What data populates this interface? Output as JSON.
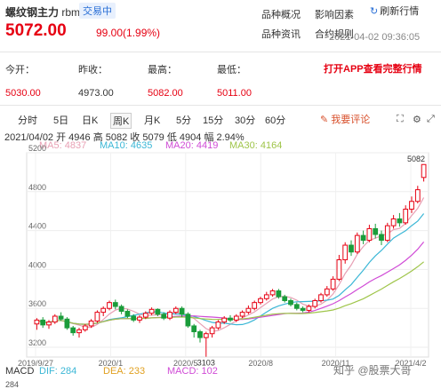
{
  "header": {
    "title": "螺纹钢主力",
    "unit": "rbm",
    "status": "交易中",
    "price": "5072.00",
    "change": "99.00(1.99%)",
    "links": [
      "品种概况",
      "影响因素",
      "品种资讯",
      "合约规则"
    ],
    "refresh": "刷新行情",
    "datetime": "2021-04-02 09:36:05"
  },
  "quote": {
    "labels": [
      "今开：",
      "昨收：",
      "最高：",
      "最低："
    ],
    "values": [
      "5030.00",
      "4973.00",
      "5082.00",
      "5011.00"
    ],
    "open_app": "打开APP查看完整行情"
  },
  "tabs": [
    "分时",
    "5日",
    "日K",
    "周K",
    "月K",
    "5分",
    "15分",
    "30分",
    "60分"
  ],
  "active_tab": "周K",
  "comment_label": "我要评论",
  "ohlc_line": "2021/04/02  开 4946  高 5082  收 5079  低 4904  幅 2.94%",
  "ma": [
    {
      "label": "MA5: 4837",
      "color": "#e8a0b4"
    },
    {
      "label": "MA10: 4635",
      "color": "#3bb7d6"
    },
    {
      "label": "MA20: 4419",
      "color": "#d04bd6"
    },
    {
      "label": "MA30: 4164",
      "color": "#9fc54a"
    }
  ],
  "macd": [
    {
      "label": "MACD",
      "color": "#333333"
    },
    {
      "label": "DIF: 284",
      "color": "#3bb7d6"
    },
    {
      "label": "DEA: 233",
      "color": "#e0a020"
    },
    {
      "label": "MACD: 102",
      "color": "#d04bd6"
    }
  ],
  "macd_axis": "284",
  "watermark": "知乎 @股票大哥",
  "chart_data": {
    "type": "candlestick",
    "y_ticks": [
      "5200",
      "4800",
      "4400",
      "4000",
      "3600",
      "3200"
    ],
    "ylim": [
      3100,
      5200
    ],
    "x_ticks": [
      "2019/9/27",
      "2020/1",
      "2020/5",
      "2020/8",
      "2020/11",
      "2021/4/2"
    ],
    "high_label": "5082",
    "low_label": "3103",
    "candles": [
      [
        3440,
        3480,
        3380,
        3500
      ],
      [
        3480,
        3430,
        3400,
        3510
      ],
      [
        3430,
        3460,
        3390,
        3480
      ],
      [
        3460,
        3520,
        3440,
        3540
      ],
      [
        3520,
        3490,
        3470,
        3560
      ],
      [
        3490,
        3400,
        3380,
        3510
      ],
      [
        3400,
        3350,
        3320,
        3420
      ],
      [
        3350,
        3380,
        3300,
        3400
      ],
      [
        3380,
        3420,
        3360,
        3440
      ],
      [
        3420,
        3470,
        3400,
        3490
      ],
      [
        3470,
        3560,
        3450,
        3580
      ],
      [
        3560,
        3600,
        3520,
        3620
      ],
      [
        3600,
        3660,
        3580,
        3680
      ],
      [
        3660,
        3620,
        3590,
        3690
      ],
      [
        3620,
        3570,
        3540,
        3640
      ],
      [
        3570,
        3520,
        3500,
        3590
      ],
      [
        3520,
        3480,
        3460,
        3540
      ],
      [
        3480,
        3510,
        3450,
        3530
      ],
      [
        3510,
        3550,
        3490,
        3570
      ],
      [
        3550,
        3590,
        3530,
        3610
      ],
      [
        3590,
        3540,
        3520,
        3600
      ],
      [
        3540,
        3500,
        3480,
        3560
      ],
      [
        3500,
        3560,
        3480,
        3580
      ],
      [
        3560,
        3600,
        3540,
        3620
      ],
      [
        3600,
        3540,
        3510,
        3620
      ],
      [
        3540,
        3420,
        3400,
        3560
      ],
      [
        3420,
        3360,
        3300,
        3440
      ],
      [
        3360,
        3300,
        3250,
        3380
      ],
      [
        3300,
        3340,
        3103,
        3360
      ],
      [
        3340,
        3400,
        3300,
        3420
      ],
      [
        3400,
        3460,
        3380,
        3480
      ],
      [
        3460,
        3500,
        3440,
        3520
      ],
      [
        3500,
        3480,
        3460,
        3530
      ],
      [
        3480,
        3520,
        3460,
        3540
      ],
      [
        3520,
        3560,
        3500,
        3580
      ],
      [
        3560,
        3600,
        3540,
        3630
      ],
      [
        3600,
        3660,
        3580,
        3680
      ],
      [
        3660,
        3700,
        3640,
        3720
      ],
      [
        3700,
        3740,
        3680,
        3770
      ],
      [
        3740,
        3780,
        3720,
        3800
      ],
      [
        3780,
        3720,
        3700,
        3800
      ],
      [
        3720,
        3680,
        3660,
        3740
      ],
      [
        3680,
        3640,
        3620,
        3700
      ],
      [
        3640,
        3600,
        3580,
        3660
      ],
      [
        3600,
        3580,
        3560,
        3620
      ],
      [
        3580,
        3620,
        3560,
        3640
      ],
      [
        3620,
        3680,
        3600,
        3700
      ],
      [
        3680,
        3740,
        3660,
        3760
      ],
      [
        3740,
        3800,
        3720,
        3830
      ],
      [
        3800,
        3900,
        3780,
        3930
      ],
      [
        3900,
        4100,
        3880,
        4150
      ],
      [
        4100,
        4250,
        4060,
        4280
      ],
      [
        4250,
        4180,
        4140,
        4300
      ],
      [
        4180,
        4350,
        4160,
        4380
      ],
      [
        4350,
        4300,
        4260,
        4400
      ],
      [
        4300,
        4420,
        4280,
        4460
      ],
      [
        4420,
        4360,
        4320,
        4470
      ],
      [
        4360,
        4300,
        4250,
        4400
      ],
      [
        4300,
        4450,
        4280,
        4480
      ],
      [
        4450,
        4520,
        4420,
        4560
      ],
      [
        4520,
        4480,
        4440,
        4580
      ],
      [
        4480,
        4620,
        4460,
        4660
      ],
      [
        4620,
        4700,
        4580,
        4750
      ],
      [
        4700,
        4820,
        4680,
        4860
      ],
      [
        4946,
        5079,
        4904,
        5082
      ]
    ]
  }
}
